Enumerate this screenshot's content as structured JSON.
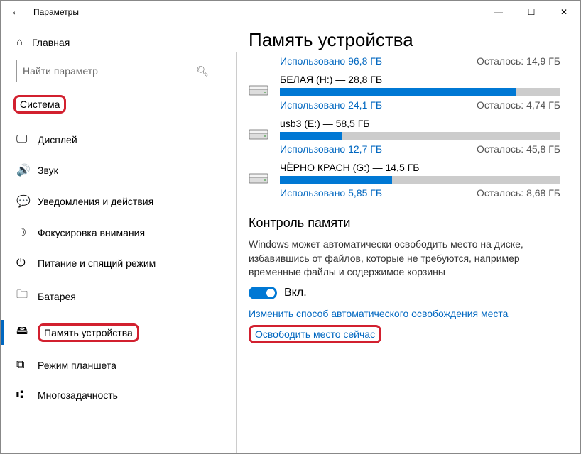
{
  "window": {
    "title": "Параметры",
    "back_icon": "←",
    "minimize": "—",
    "maximize": "☐",
    "close": "✕"
  },
  "sidebar": {
    "home_icon": "⌂",
    "home_label": "Главная",
    "search_placeholder": "Найти параметр",
    "search_icon": "🔍︎",
    "section_label": "Система",
    "items": [
      {
        "icon": "🖵",
        "label": "Дисплей"
      },
      {
        "icon": "🔊",
        "label": "Звук"
      },
      {
        "icon": "💬",
        "label": "Уведомления и действия"
      },
      {
        "icon": "☽",
        "label": "Фокусировка внимания"
      },
      {
        "icon": "⏻",
        "label": "Питание и спящий режим"
      },
      {
        "icon": "🗀",
        "label": "Батарея"
      },
      {
        "icon": "🖴",
        "label": "Память устройства"
      },
      {
        "icon": "⧉",
        "label": "Режим планшета"
      },
      {
        "icon": "⑆",
        "label": "Многозадачность"
      }
    ]
  },
  "main": {
    "title": "Память устройства",
    "top_used": "Использовано 96,8 ГБ",
    "top_free": "Осталось: 14,9 ГБ",
    "drives": [
      {
        "name": "БЕЛАЯ (H:) — 28,8 ГБ",
        "used_label": "Использовано 24,1 ГБ",
        "free_label": "Осталось: 4,74 ГБ",
        "fill_pct": 84
      },
      {
        "name": "usb3 (E:) — 58,5 ГБ",
        "used_label": "Использовано 12,7 ГБ",
        "free_label": "Осталось: 45,8 ГБ",
        "fill_pct": 22
      },
      {
        "name": "ЧЁРНО КРАСН (G:) — 14,5 ГБ",
        "used_label": "Использовано 5,85 ГБ",
        "free_label": "Осталось: 8,68 ГБ",
        "fill_pct": 40
      }
    ],
    "storage_sense": {
      "heading": "Контроль памяти",
      "description": "Windows может автоматически освободить место на диске, избавившись от файлов, которые не требуются, например временные файлы и содержимое корзины",
      "toggle_label": "Вкл.",
      "link1": "Изменить способ автоматического освобождения места",
      "link2": "Освободить место сейчас"
    }
  }
}
